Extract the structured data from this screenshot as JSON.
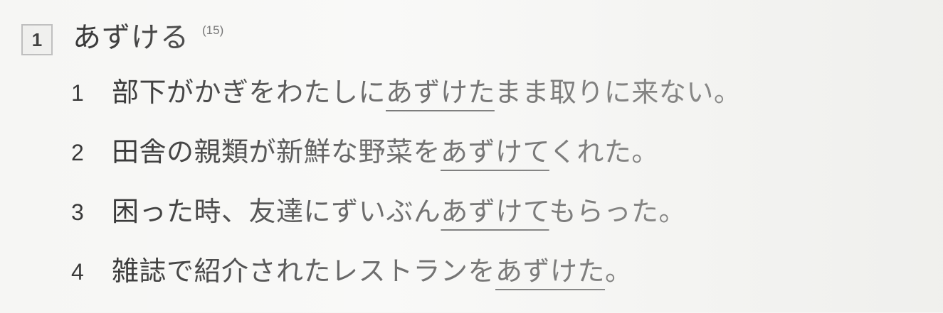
{
  "question": {
    "number": "1",
    "headword": "あずける",
    "headword_ref": "(15)"
  },
  "options": [
    {
      "num": "1",
      "before": "部下がかぎをわたしに",
      "target": "あずけた",
      "after": "まま取りに来ない。"
    },
    {
      "num": "2",
      "before": "田舎の親類が新鮮な野菜を",
      "target": "あずけて",
      "after": "くれた。"
    },
    {
      "num": "3",
      "before": "困った時、友達にずいぶん",
      "target": "あずけて",
      "after": "もらった。"
    },
    {
      "num": "4",
      "before": "雑誌で紹介されたレストランを",
      "target": "あずけた",
      "after": "。"
    }
  ]
}
